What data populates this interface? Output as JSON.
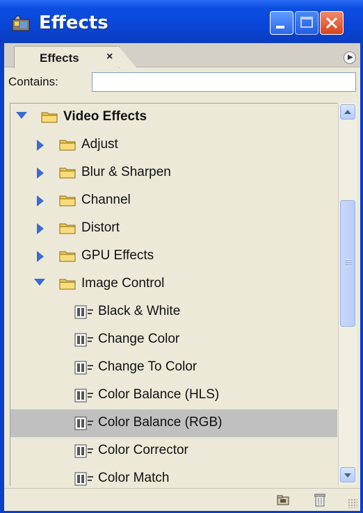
{
  "window": {
    "title": "Effects",
    "icon": "effects-app-icon",
    "controls": [
      "minimize",
      "maximize",
      "close"
    ]
  },
  "panel": {
    "tab_label": "Effects",
    "tab_close": "×",
    "menu_icon": "panel-menu-icon"
  },
  "search": {
    "label": "Contains:",
    "value": ""
  },
  "tree": {
    "items": [
      {
        "label": "Video Effects",
        "type": "folder",
        "expanded": true,
        "level": 0,
        "bold": true
      },
      {
        "label": "Adjust",
        "type": "folder",
        "expanded": false,
        "level": 1
      },
      {
        "label": "Blur & Sharpen",
        "type": "folder",
        "expanded": false,
        "level": 1
      },
      {
        "label": "Channel",
        "type": "folder",
        "expanded": false,
        "level": 1
      },
      {
        "label": "Distort",
        "type": "folder",
        "expanded": false,
        "level": 1
      },
      {
        "label": "GPU Effects",
        "type": "folder",
        "expanded": false,
        "level": 1
      },
      {
        "label": "Image Control",
        "type": "folder",
        "expanded": true,
        "level": 1
      },
      {
        "label": "Black & White",
        "type": "effect",
        "level": 2
      },
      {
        "label": "Change Color",
        "type": "effect",
        "level": 2
      },
      {
        "label": "Change To Color",
        "type": "effect",
        "level": 2
      },
      {
        "label": "Color Balance (HLS)",
        "type": "effect",
        "level": 2
      },
      {
        "label": "Color Balance (RGB)",
        "type": "effect",
        "level": 2,
        "selected": true
      },
      {
        "label": "Color Corrector",
        "type": "effect",
        "level": 2
      },
      {
        "label": "Color Match",
        "type": "effect",
        "level": 2
      }
    ]
  },
  "footer": {
    "icons": [
      "new-custom-bin-icon",
      "delete-icon"
    ]
  },
  "colors": {
    "titlebar": "#0a46d6",
    "selection": "#c0c0c0",
    "panel": "#ece9d8",
    "twisty": "#3d6ad1",
    "folder": "#f2c94c"
  }
}
